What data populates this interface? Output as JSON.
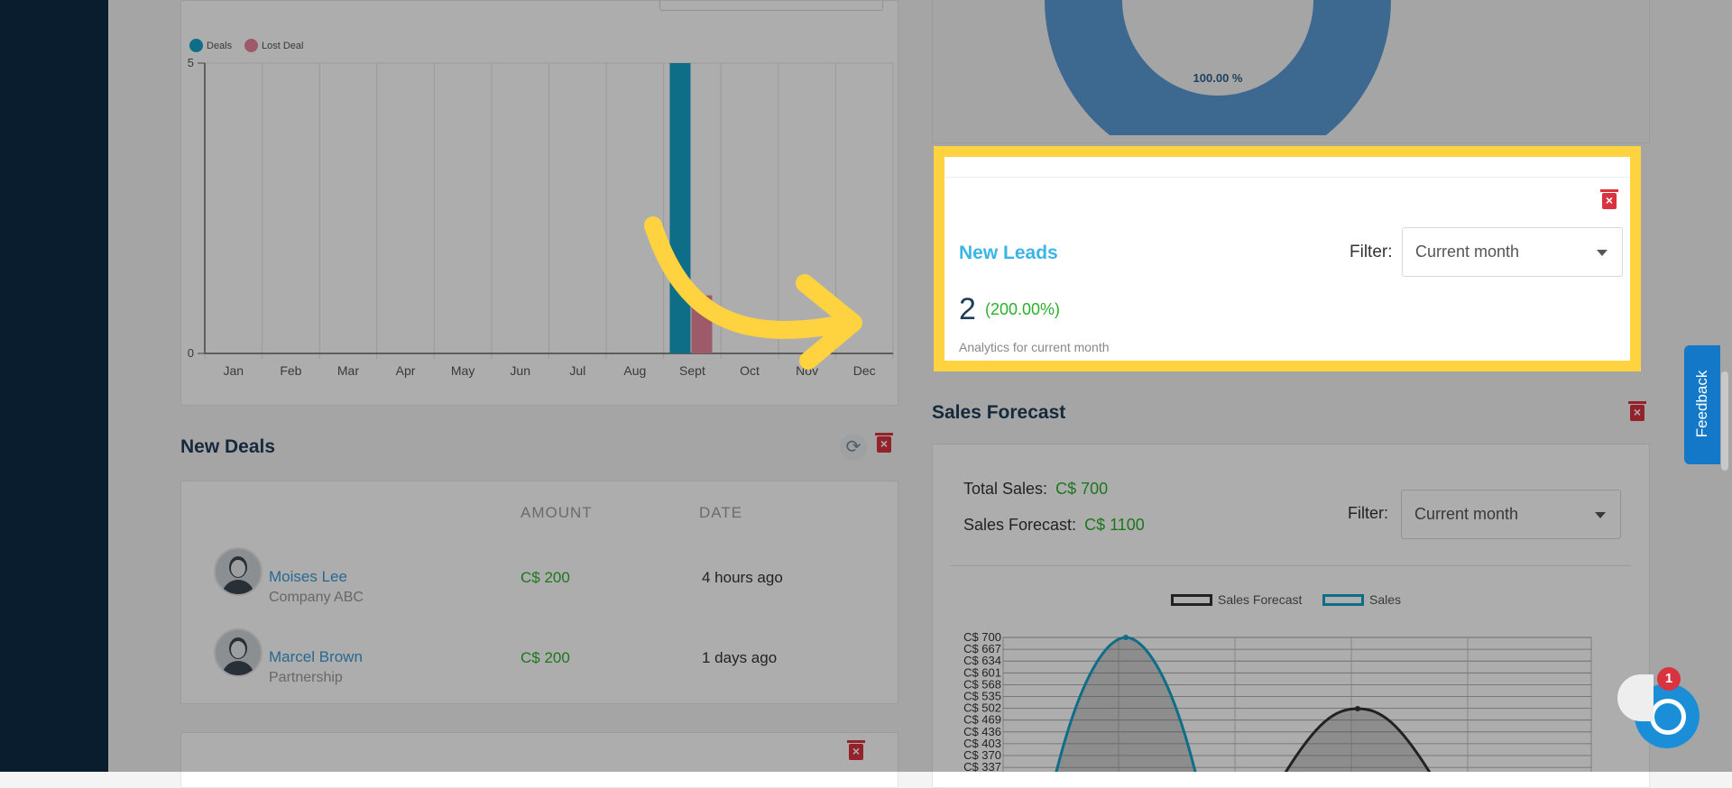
{
  "deals_chart": {
    "legend": [
      {
        "name": "Deals",
        "color": "#17a2c8"
      },
      {
        "name": "Lost Deal",
        "color": "#e8859a"
      }
    ],
    "chart_data": {
      "type": "bar",
      "categories": [
        "Jan",
        "Feb",
        "Mar",
        "Apr",
        "May",
        "Jun",
        "Jul",
        "Aug",
        "Sept",
        "Oct",
        "Nov",
        "Dec"
      ],
      "series": [
        {
          "name": "Deals",
          "values": [
            0,
            0,
            0,
            0,
            0,
            0,
            0,
            0,
            5,
            0,
            0,
            0
          ]
        },
        {
          "name": "Lost Deal",
          "values": [
            0,
            0,
            0,
            0,
            0,
            0,
            0,
            0,
            1,
            0,
            0,
            0
          ]
        }
      ],
      "ylim": [
        0,
        5
      ],
      "yticks": [
        "0",
        "5"
      ]
    }
  },
  "pie": {
    "label": "100.00 %"
  },
  "new_leads": {
    "title": "New Leads",
    "filter_label": "Filter:",
    "filter_value": "Current month",
    "count": "2",
    "change": "(200.00%)",
    "caption": "Analytics for current month"
  },
  "new_deals": {
    "title": "New Deals",
    "columns": [
      "AMOUNT",
      "DATE"
    ],
    "rows": [
      {
        "name": "Moises Lee",
        "company": "Company ABC",
        "amount": "C$ 200",
        "date": "4 hours ago"
      },
      {
        "name": "Marcel Brown",
        "company": "Partnership",
        "amount": "C$ 200",
        "date": "1 days ago"
      }
    ]
  },
  "sales_forecast": {
    "title": "Sales Forecast",
    "total_label": "Total Sales:",
    "total_value": "C$ 700",
    "forecast_label": "Sales Forecast:",
    "forecast_value": "C$ 1100",
    "filter_label": "Filter:",
    "filter_value": "Current month",
    "legend": [
      {
        "name": "Sales Forecast",
        "color": "#333333"
      },
      {
        "name": "Sales",
        "color": "#17a2c8"
      }
    ],
    "chart_data": {
      "type": "line",
      "yticks": [
        "C$ 700",
        "C$ 667",
        "C$ 634",
        "C$ 601",
        "C$ 568",
        "C$ 535",
        "C$ 502",
        "C$ 469",
        "C$ 436",
        "C$ 403",
        "C$ 370",
        "C$ 337"
      ]
    }
  },
  "feedback": {
    "label": "Feedback"
  },
  "chat": {
    "badge": "1"
  }
}
